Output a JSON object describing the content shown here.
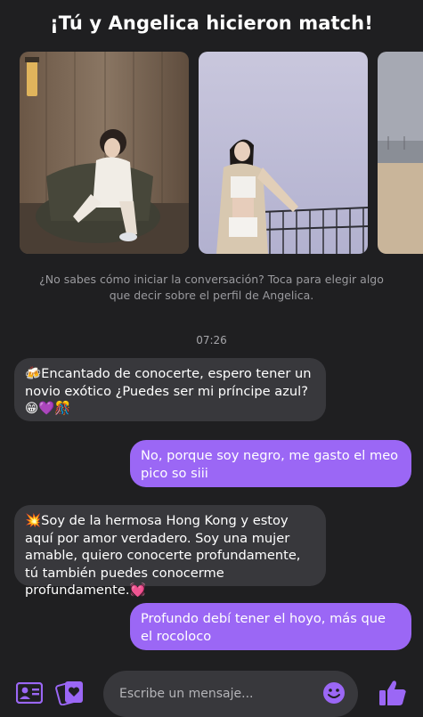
{
  "header": {
    "title": "¡Tú y Angelica hicieron match!"
  },
  "gallery": {
    "photos": [
      {
        "name": "profile-photo-1"
      },
      {
        "name": "profile-photo-2"
      },
      {
        "name": "profile-photo-3"
      }
    ]
  },
  "hint": {
    "text": "¿No sabes cómo iniciar la conversación? Toca para elegir algo que decir sobre el perfil de Angelica."
  },
  "chat": {
    "timestamp": "07:26",
    "messages": [
      {
        "from": "Angelica",
        "text": "🍻Encantado de conocerte, espero tener un novio exótico ¿Puedes ser mi príncipe azul? 😁💜🎊"
      },
      {
        "from": "me",
        "text": "No, porque soy negro, me gasto el meo pico so siii"
      },
      {
        "from": "Angelica",
        "text": "💥Soy de la hermosa Hong Kong y estoy aquí por amor verdadero. Soy una mujer amable, quiero conocerte profundamente, tú también puedes conocerme profundamente.💓"
      },
      {
        "from": "me",
        "text": "Profundo debí tener el hoyo, más que el rocoloco"
      }
    ]
  },
  "composer": {
    "placeholder": "Escribe un mensaje...",
    "icons": {
      "profile": "profile-card-icon",
      "cards": "heart-cards-icon",
      "emoji": "smiley-icon",
      "like": "thumbs-up-icon"
    }
  },
  "colors": {
    "background": "#1f1f21",
    "incoming_bubble": "#38383c",
    "outgoing_bubble": "#9b67f5",
    "accent": "#9b67f5"
  }
}
